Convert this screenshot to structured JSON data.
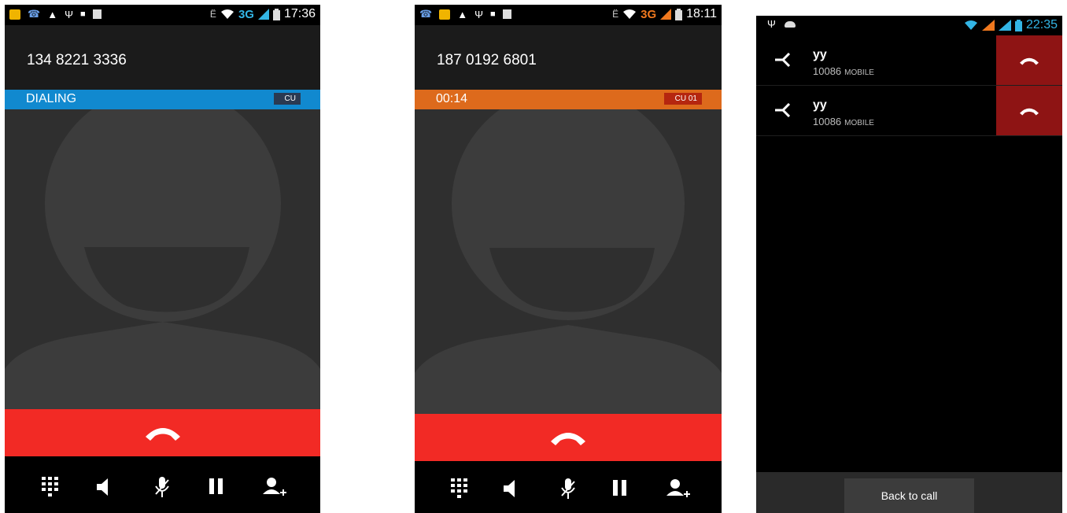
{
  "phones": [
    {
      "status": {
        "time": "17:36",
        "network": "3G"
      },
      "call": {
        "number": "134 8221 3336",
        "state": "DIALING",
        "sim_tag": "CU",
        "banner_color": "#1189cf"
      },
      "toolbar": [
        "dialpad-icon",
        "speaker-icon",
        "mute-icon",
        "hold-icon",
        "add-call-icon"
      ]
    },
    {
      "status": {
        "time": "18:11",
        "network": "3G"
      },
      "call": {
        "number": "187 0192 6801",
        "state": "00:14",
        "sim_tag": "CU 01",
        "banner_color": "#dd6a1c"
      },
      "toolbar": [
        "dialpad-icon",
        "speaker-icon",
        "mute-icon",
        "hold-icon",
        "add-call-icon"
      ]
    },
    {
      "status": {
        "time": "22:35"
      },
      "conference": [
        {
          "name": "yy",
          "number": "10086",
          "type": "MOBILE"
        },
        {
          "name": "yy",
          "number": "10086",
          "type": "MOBILE"
        }
      ],
      "back_label": "Back to call"
    }
  ],
  "colors": {
    "end_call": "#f22a25",
    "conference_hangup": "#8e1414",
    "clock_blue": "#33b5e5"
  },
  "icons": [
    "sms-icon",
    "warning-icon",
    "usb-icon",
    "lock-icon",
    "bluetooth-icon",
    "wifi-icon",
    "signal-icon",
    "battery-icon",
    "end-call-icon",
    "split-call-icon"
  ]
}
